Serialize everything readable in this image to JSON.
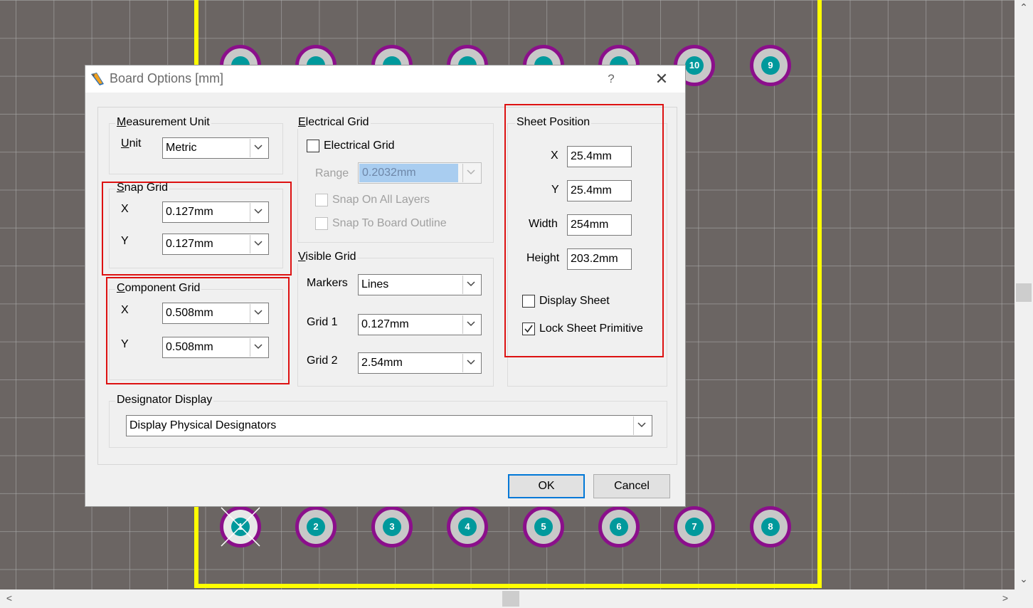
{
  "dialog": {
    "title": "Board Options [mm]",
    "help_label": "?",
    "close_label": "✕"
  },
  "measurement_unit": {
    "legend_first": "M",
    "legend_rest": "easurement Unit",
    "unit_label_first": "U",
    "unit_label_rest": "nit",
    "unit_value": "Metric"
  },
  "snap_grid": {
    "legend_first": "S",
    "legend_rest": "nap Grid",
    "x_label": "X",
    "x_value": "0.127mm",
    "y_label": "Y",
    "y_value": "0.127mm"
  },
  "component_grid": {
    "legend_first": "C",
    "legend_rest": "omponent Grid",
    "x_label": "X",
    "x_value": "0.508mm",
    "y_label": "Y",
    "y_value": "0.508mm"
  },
  "electrical_grid": {
    "legend_first": "E",
    "legend_rest": "lectrical Grid",
    "checkbox_label": "Electrical Grid",
    "checked": false,
    "range_label": "Range",
    "range_value": "0.2032mm",
    "snap_all_layers_label": "Snap On All Layers",
    "snap_board_outline_label": "Snap To Board Outline"
  },
  "visible_grid": {
    "legend_first": "V",
    "legend_rest": "isible Grid",
    "markers_label": "Markers",
    "markers_value": "Lines",
    "grid1_label": "Grid 1",
    "grid1_value": "0.127mm",
    "grid2_label": "Grid 2",
    "grid2_value": "2.54mm"
  },
  "sheet_position": {
    "legend": "Sheet Position",
    "x_label": "X",
    "x_value": "25.4mm",
    "y_label": "Y",
    "y_value": "25.4mm",
    "width_label": "Width",
    "width_value": "254mm",
    "height_label": "Height",
    "height_value": "203.2mm",
    "display_sheet_label": "Display Sheet",
    "display_sheet_checked": false,
    "lock_sheet_label": "Lock Sheet Primitive",
    "lock_sheet_checked": true
  },
  "designator_display": {
    "legend": "Designator Display",
    "value": "Display Physical Designators"
  },
  "buttons": {
    "ok": "OK",
    "cancel": "Cancel"
  },
  "pcb": {
    "top_pads_visible": [
      "10",
      "9"
    ],
    "bottom_pads": [
      "1",
      "2",
      "3",
      "4",
      "5",
      "6",
      "7",
      "8"
    ],
    "pad_color": "#c8c8c8",
    "pad_ring_color": "#8b0f8b",
    "hole_color": "#00999c",
    "board_outline_color": "#ffff00"
  },
  "scrollbars": {
    "up": "⌃",
    "down": "⌄",
    "left": "<",
    "right": ">"
  },
  "highlight_color": "#dd1111"
}
